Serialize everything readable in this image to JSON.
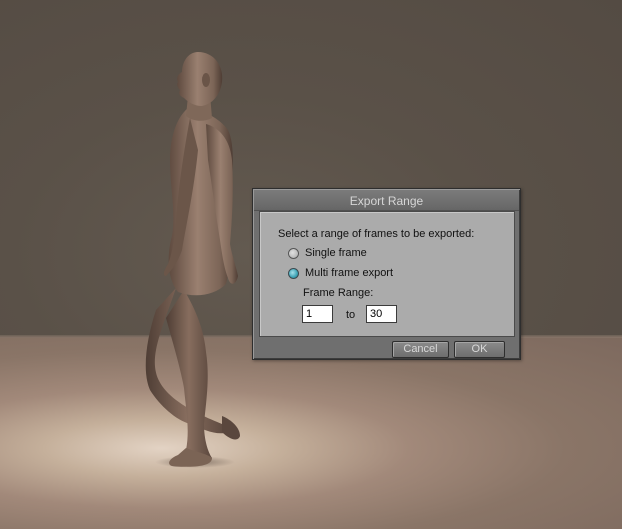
{
  "viewport": {
    "wall_color": "#5a5148",
    "floor_color": "#a2897a",
    "figure_color": "#8c7463"
  },
  "dialog": {
    "title": "Export Range",
    "instructions": "Select a range of frames to be exported:",
    "options": [
      {
        "label": "Single frame",
        "selected": false
      },
      {
        "label": "Multi frame export",
        "selected": true
      }
    ],
    "frame_range_label": "Frame Range:",
    "from_value": "1",
    "to_label": "to",
    "to_value": "30",
    "cancel_label": "Cancel",
    "ok_label": "OK"
  },
  "colors": {
    "radio_selected": "#3da3b5",
    "dialog_frame": "#6f6f6f",
    "dialog_body": "#ababab"
  }
}
